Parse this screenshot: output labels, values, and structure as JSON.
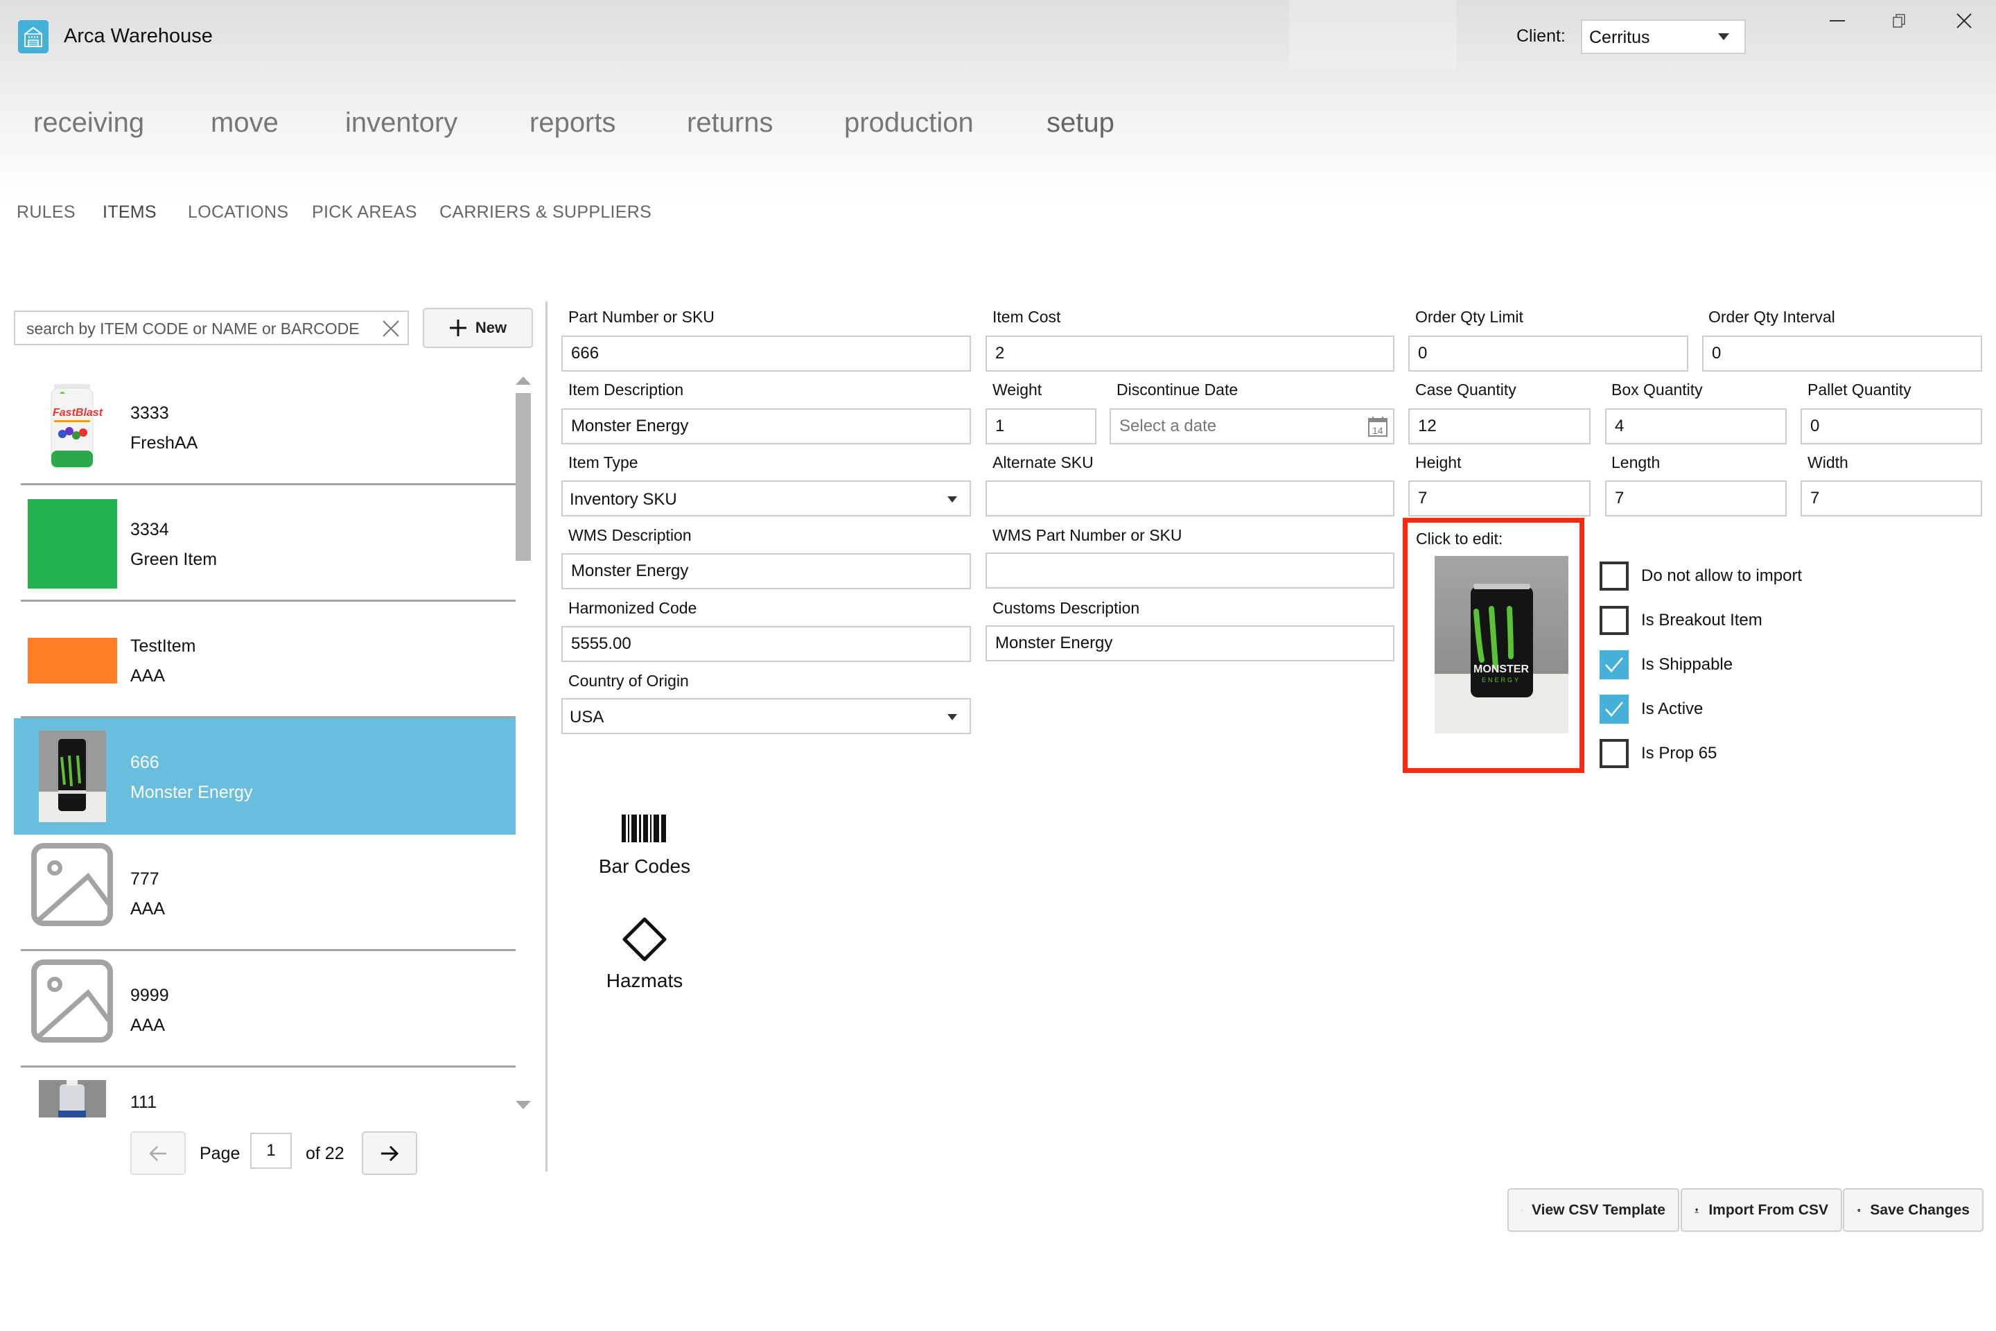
{
  "app": {
    "title": "Arca Warehouse",
    "client_label": "Client:",
    "client_value": "Cerritus"
  },
  "window_controls": {
    "minimize": "minimize",
    "restore": "restore",
    "close": "close"
  },
  "main_nav": [
    {
      "label": "receiving",
      "active": false
    },
    {
      "label": "move",
      "active": false
    },
    {
      "label": "inventory",
      "active": false
    },
    {
      "label": "reports",
      "active": false
    },
    {
      "label": "returns",
      "active": false
    },
    {
      "label": "production",
      "active": false
    },
    {
      "label": "setup",
      "active": true
    }
  ],
  "sub_nav": [
    {
      "label": "RULES",
      "active": false
    },
    {
      "label": "ITEMS",
      "active": true
    },
    {
      "label": "LOCATIONS",
      "active": false
    },
    {
      "label": "PICK AREAS",
      "active": false
    },
    {
      "label": "CARRIERS & SUPPLIERS",
      "active": false
    }
  ],
  "search": {
    "placeholder": "search by ITEM CODE or NAME or BARCODE",
    "value": ""
  },
  "new_button": {
    "label": "New",
    "icon": "plus-icon"
  },
  "items": [
    {
      "code": "3333",
      "name": "FreshAA",
      "thumb": "fastblast-product-photo",
      "selected": false
    },
    {
      "code": "3334",
      "name": "Green Item",
      "thumb": "green-swatch",
      "thumb_color": "#22b14c",
      "selected": false
    },
    {
      "code": "TestItem",
      "name": "AAA",
      "thumb": "orange-swatch",
      "thumb_color": "#ff7f27",
      "selected": false
    },
    {
      "code": "666",
      "name": "Monster Energy",
      "thumb": "monster-can-photo",
      "selected": true
    },
    {
      "code": "777",
      "name": "AAA",
      "thumb": "image-placeholder-icon",
      "selected": false
    },
    {
      "code": "9999",
      "name": "AAA",
      "thumb": "image-placeholder-icon",
      "selected": false
    },
    {
      "code": "111",
      "name": "",
      "thumb": "water-bottle-photo",
      "selected": false
    }
  ],
  "pager": {
    "label": "Page",
    "current": "1",
    "of_label": "of 22",
    "total": 22
  },
  "form": {
    "part_number": {
      "label": "Part Number or SKU",
      "value": "666"
    },
    "item_cost": {
      "label": "Item Cost",
      "value": "2"
    },
    "order_qty_limit": {
      "label": "Order Qty Limit",
      "value": "0"
    },
    "order_qty_interval": {
      "label": "Order Qty Interval",
      "value": "0"
    },
    "item_description": {
      "label": "Item Description",
      "value": "Monster Energy"
    },
    "weight": {
      "label": "Weight",
      "value": "1"
    },
    "discontinue_date": {
      "label": "Discontinue Date",
      "placeholder": "Select a date",
      "value": "",
      "icon_text": "14"
    },
    "case_quantity": {
      "label": "Case Quantity",
      "value": "12"
    },
    "box_quantity": {
      "label": "Box Quantity",
      "value": "4"
    },
    "pallet_quantity": {
      "label": "Pallet Quantity",
      "value": "0"
    },
    "item_type": {
      "label": "Item Type",
      "value": "Inventory SKU"
    },
    "alternate_sku": {
      "label": "Alternate SKU",
      "value": ""
    },
    "height": {
      "label": "Height",
      "value": "7"
    },
    "length": {
      "label": "Length",
      "value": "7"
    },
    "width": {
      "label": "Width",
      "value": "7"
    },
    "wms_description": {
      "label": "WMS Description",
      "value": "Monster Energy"
    },
    "wms_part_number": {
      "label": "WMS Part Number or SKU",
      "value": ""
    },
    "harmonized_code": {
      "label": "Harmonized Code",
      "value": "5555.00"
    },
    "customs_description": {
      "label": "Customs Description",
      "value": "Monster Energy"
    },
    "country_of_origin": {
      "label": "Country of Origin",
      "value": "USA"
    }
  },
  "image_editor": {
    "label": "Click to edit:",
    "image": "monster-can-photo",
    "highlight_color": "#ff2a0c"
  },
  "checkboxes": [
    {
      "label": "Do not allow to import",
      "checked": false
    },
    {
      "label": "Is Breakout Item",
      "checked": false
    },
    {
      "label": "Is Shippable",
      "checked": true
    },
    {
      "label": "Is Active",
      "checked": true
    },
    {
      "label": "Is Prop 65",
      "checked": false
    }
  ],
  "tools": [
    {
      "label": "Bar Codes",
      "icon": "barcode-icon"
    },
    {
      "label": "Hazmats",
      "icon": "diamond-icon"
    }
  ],
  "actions": [
    {
      "label": "View CSV Template",
      "icon": "document-icon"
    },
    {
      "label": "Import From CSV",
      "icon": "upload-icon"
    },
    {
      "label": "Save Changes",
      "icon": "database-save-icon"
    }
  ],
  "colors": {
    "accent": "#45b1d8",
    "selected_row": "#68bedc",
    "highlight": "#ff2a0c"
  }
}
